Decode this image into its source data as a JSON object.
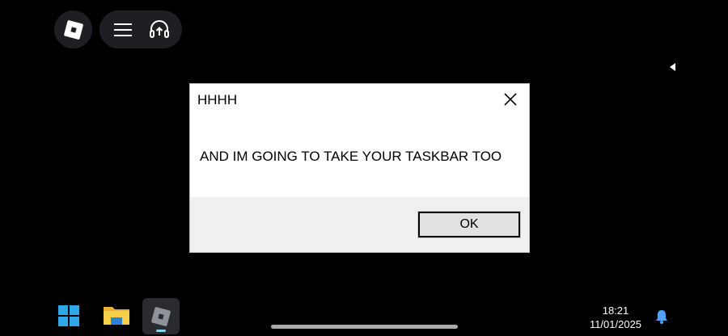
{
  "dialog": {
    "title": "HHHH",
    "message": "AND IM GOING TO TAKE YOUR TASKBAR TOO",
    "ok_label": "OK"
  },
  "taskbar": {
    "time": "18:21",
    "date": "11/01/2025",
    "accent": "#2fa8ea"
  },
  "icons": {
    "roblox": "roblox-logo-icon",
    "menu": "menu-icon",
    "headset": "headset-icon",
    "back_arrow": "arrow-left-icon",
    "close": "close-icon",
    "windows": "windows-logo-icon",
    "file_explorer": "folder-icon",
    "notifications": "bell-icon"
  }
}
